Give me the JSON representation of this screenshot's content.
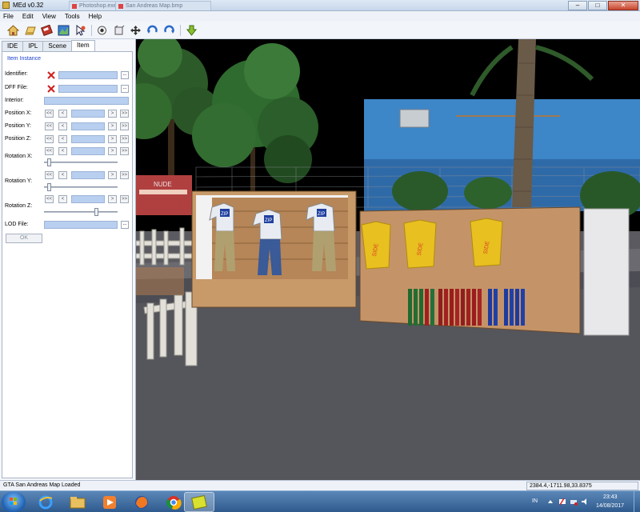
{
  "window": {
    "title": "MEd v0.32",
    "ghost_tabs": [
      "Photoshop.exe (3 Wh...",
      "San Andreas Map.bmp"
    ],
    "controls": [
      "minimize",
      "maximize",
      "close"
    ]
  },
  "menu": [
    "File",
    "Edit",
    "View",
    "Tools",
    "Help"
  ],
  "toolbar": {
    "icons": [
      "home-icon",
      "open-icon",
      "save-icon",
      "map-icon",
      "select-icon",
      "point-icon",
      "box-icon",
      "move-icon",
      "rotate-left-icon",
      "rotate-right-icon",
      "download-icon"
    ]
  },
  "tabs": [
    "IDE",
    "IPL",
    "Scene",
    "Item"
  ],
  "active_tab": "Item",
  "item_panel": {
    "group_title": "Item Instance",
    "identifier_label": "Identifier:",
    "dff_label": "DFF File:",
    "interior_label": "Interior:",
    "posx_label": "Position X:",
    "posy_label": "Position Y:",
    "posz_label": "Position Z:",
    "rotx_label": "Rotation X:",
    "roty_label": "Rotation Y:",
    "rotz_label": "Rotation Z:",
    "lod_label": "LOD File:",
    "browse": "...",
    "arrow_far_left": "<<",
    "arrow_left": "<",
    "arrow_right": ">",
    "arrow_far_right": ">>",
    "ok_label": "OK",
    "sliders": {
      "rot_x": 0.05,
      "rot_y": 0.05,
      "rot_z": 0.72
    }
  },
  "status": {
    "text": "GTA San Andreas Map Loaded",
    "coords": "2384.4,-1711.98,33.8375"
  },
  "taskbar": {
    "apps": [
      "windows-explorer-icon",
      "internet-explorer-icon",
      "file-explorer-icon",
      "media-player-icon",
      "firefox-icon",
      "chrome-icon",
      "med-icon"
    ],
    "language": "IN",
    "time": "23:43",
    "date": "14/08/2017"
  },
  "scene": {
    "sign_text": "NUDE",
    "shirt_logo": "ZIP",
    "yellow_shirt_text": "SIDE",
    "colors": {
      "sky": "#000000",
      "road": "#4c4c54",
      "wall": "#3d86c8",
      "board": "#c89a6a",
      "tree": "#2f6a2e"
    }
  }
}
